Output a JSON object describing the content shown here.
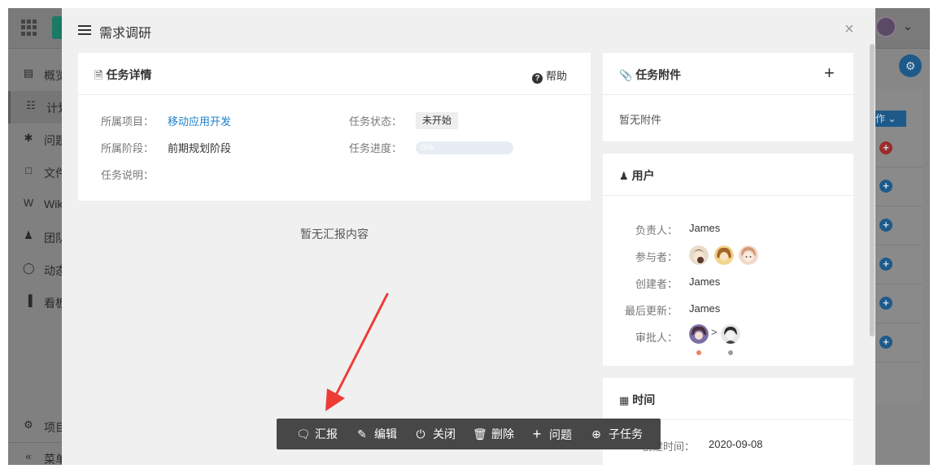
{
  "background": {
    "sidebar_items": [
      {
        "label": "概览",
        "icon": "list-icon"
      },
      {
        "label": "计划",
        "icon": "hierarchy-icon"
      },
      {
        "label": "问题",
        "icon": "bug-icon"
      },
      {
        "label": "文件",
        "icon": "folder-icon"
      },
      {
        "label": "Wiki",
        "icon": "wiki-icon"
      },
      {
        "label": "团队",
        "icon": "team-icon"
      },
      {
        "label": "动态",
        "icon": "fire-icon"
      },
      {
        "label": "看板",
        "icon": "chart-icon"
      }
    ],
    "footer_items": [
      {
        "label": "项目",
        "icon": "gear-icon"
      },
      {
        "label": "菜单",
        "icon": "double-chevron-left-icon"
      }
    ],
    "action_label": "作"
  },
  "modal": {
    "title": "需求调研",
    "close_label": "×"
  },
  "task_details": {
    "title": "任务详情",
    "help_label": "帮助",
    "project_label": "所属项目：",
    "project_value": "移动应用开发",
    "stage_label": "所属阶段：",
    "stage_value": "前期规划阶段",
    "desc_label": "任务说明：",
    "status_label": "任务状态：",
    "status_value": "未开始",
    "progress_label": "任务进度：",
    "progress_text": "0%",
    "progress_value": 0
  },
  "report": {
    "empty_text": "暂无汇报内容"
  },
  "attachments": {
    "title": "任务附件",
    "add_label": "+",
    "empty_text": "暂无附件"
  },
  "users": {
    "title": "用户",
    "owner_label": "负责人：",
    "owner_value": "James",
    "participants_label": "参与者：",
    "creator_label": "创建者：",
    "creator_value": "James",
    "updated_label": "最后更新：",
    "updated_value": "James",
    "approver_label": "审批人：",
    "approver_separator": ">",
    "approver_status_colors": [
      "#e8866a",
      "#9a9a9a"
    ]
  },
  "time": {
    "title": "时间",
    "created_label": "创建时间：",
    "created_value": "2020-09-08"
  },
  "actions": [
    {
      "label": "汇报",
      "icon": "comment-icon"
    },
    {
      "label": "编辑",
      "icon": "pencil-icon"
    },
    {
      "label": "关闭",
      "icon": "power-icon"
    },
    {
      "label": "删除",
      "icon": "trash-icon"
    },
    {
      "label": "问题",
      "icon": "plus-icon"
    },
    {
      "label": "子任务",
      "icon": "add-circle-icon"
    }
  ],
  "colors": {
    "link": "#1f80c8",
    "action_bar": "#474747",
    "annotation_arrow": "#ef3b36"
  }
}
